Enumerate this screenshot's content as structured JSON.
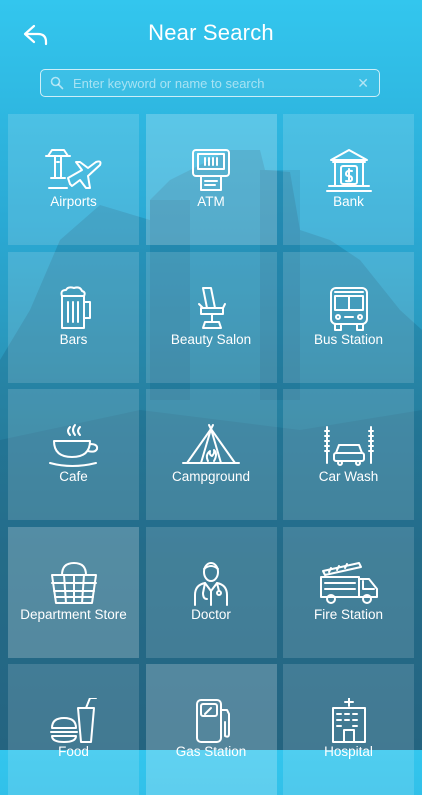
{
  "header": {
    "title": "Near Search"
  },
  "search": {
    "placeholder": "Enter keyword or name to search",
    "value": ""
  },
  "categories": [
    {
      "label": "Airports",
      "icon": "airport-icon"
    },
    {
      "label": "ATM",
      "icon": "atm-icon"
    },
    {
      "label": "Bank",
      "icon": "bank-icon"
    },
    {
      "label": "Bars",
      "icon": "beer-icon"
    },
    {
      "label": "Beauty Salon",
      "icon": "salon-chair-icon"
    },
    {
      "label": "Bus Station",
      "icon": "bus-icon"
    },
    {
      "label": "Cafe",
      "icon": "coffee-cup-icon"
    },
    {
      "label": "Campground",
      "icon": "tent-icon"
    },
    {
      "label": "Car Wash",
      "icon": "car-wash-icon"
    },
    {
      "label": "Department Store",
      "icon": "basket-icon"
    },
    {
      "label": "Doctor",
      "icon": "doctor-icon"
    },
    {
      "label": "Fire Station",
      "icon": "fire-truck-icon"
    },
    {
      "label": "Food",
      "icon": "fast-food-icon"
    },
    {
      "label": "Gas Station",
      "icon": "gas-pump-icon"
    },
    {
      "label": "Hospital",
      "icon": "hospital-icon"
    }
  ]
}
